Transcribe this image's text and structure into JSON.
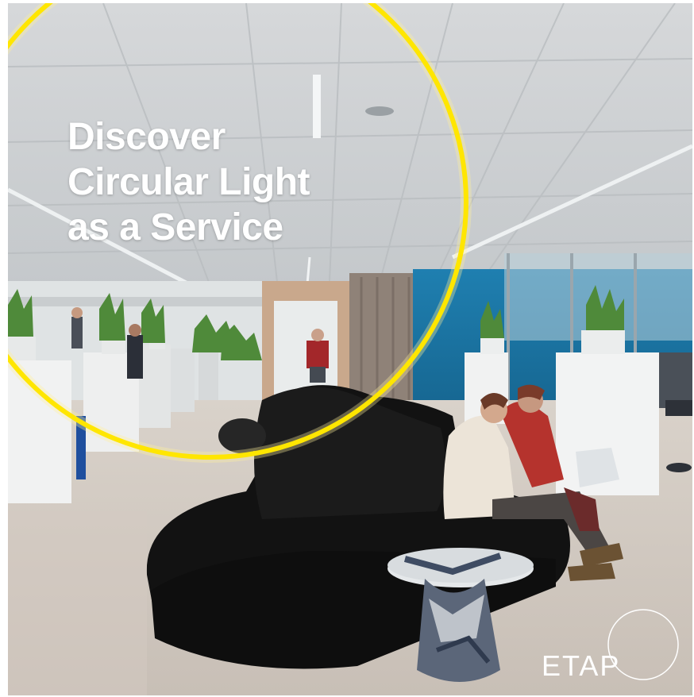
{
  "headline": {
    "line1": "Discover",
    "line2": "Circular Light",
    "line3": "as a Service"
  },
  "brand": {
    "name": "ETAP",
    "accent_color": "#ffe600"
  },
  "photo": {
    "icon": "office-lounge-photo"
  }
}
